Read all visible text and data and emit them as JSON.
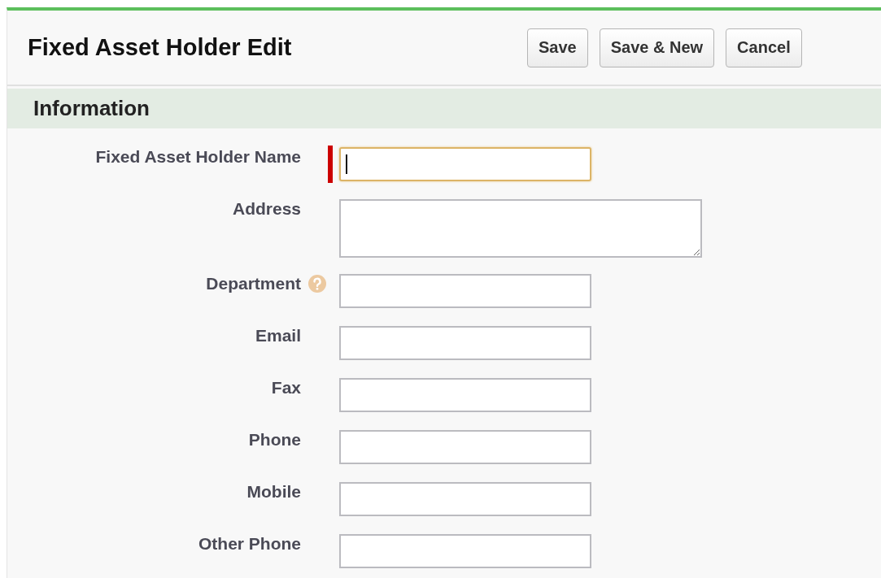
{
  "header": {
    "title": "Fixed Asset Holder Edit",
    "buttons": [
      "Save",
      "Save & New",
      "Cancel"
    ]
  },
  "section": {
    "title": "Information"
  },
  "fields": [
    {
      "label": "Fixed Asset Holder Name",
      "kind": "text",
      "required": true,
      "focused": true,
      "help": false
    },
    {
      "label": "Address",
      "kind": "textarea",
      "required": false,
      "focused": false,
      "help": false
    },
    {
      "label": "Department",
      "kind": "text",
      "required": false,
      "focused": false,
      "help": true
    },
    {
      "label": "Email",
      "kind": "text",
      "required": false,
      "focused": false,
      "help": false
    },
    {
      "label": "Fax",
      "kind": "text",
      "required": false,
      "focused": false,
      "help": false
    },
    {
      "label": "Phone",
      "kind": "text",
      "required": false,
      "focused": false,
      "help": false
    },
    {
      "label": "Mobile",
      "kind": "text",
      "required": false,
      "focused": false,
      "help": false
    },
    {
      "label": "Other Phone",
      "kind": "text",
      "required": false,
      "focused": false,
      "help": false
    }
  ]
}
